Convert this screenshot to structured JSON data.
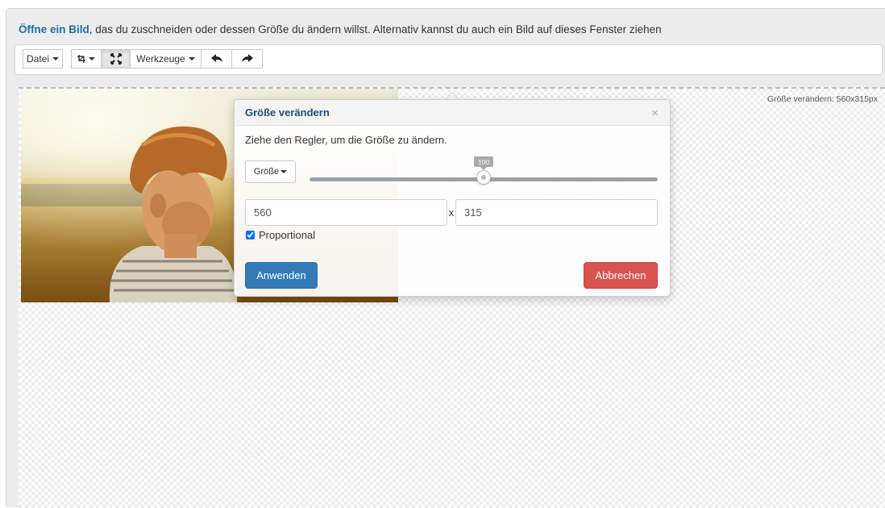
{
  "intro": {
    "link_text": "Öffne ein Bild",
    "rest_text": ", das du zuschneiden oder dessen Größe du ändern willst. Alternativ kannst du auch ein Bild auf dieses Fenster ziehen"
  },
  "toolbar": {
    "file_label": "Datei",
    "tools_label": "Werkzeuge",
    "icons": [
      "crop-icon",
      "resize-icon",
      "undo-icon",
      "redo-icon"
    ]
  },
  "canvas": {
    "size_label": "Größe verändern: 560x315px"
  },
  "resize_dialog": {
    "title": "Größe verändern",
    "close_symbol": "×",
    "hint": "Ziehe den Regler, um die Größe zu ändern.",
    "mode_dropdown": "Größe",
    "slider_value": "100",
    "slider_fraction": 0.5,
    "width_value": "560",
    "separator": "x",
    "height_value": "315",
    "proportional_label": "Proportional",
    "proportional_checked": true,
    "apply_label": "Anwenden",
    "cancel_label": "Abbrechen"
  },
  "colors": {
    "link": "#1d6fa5",
    "apply_button": "#337ab7",
    "cancel_button": "#d9534f",
    "dialog_title": "#1f4e79"
  }
}
